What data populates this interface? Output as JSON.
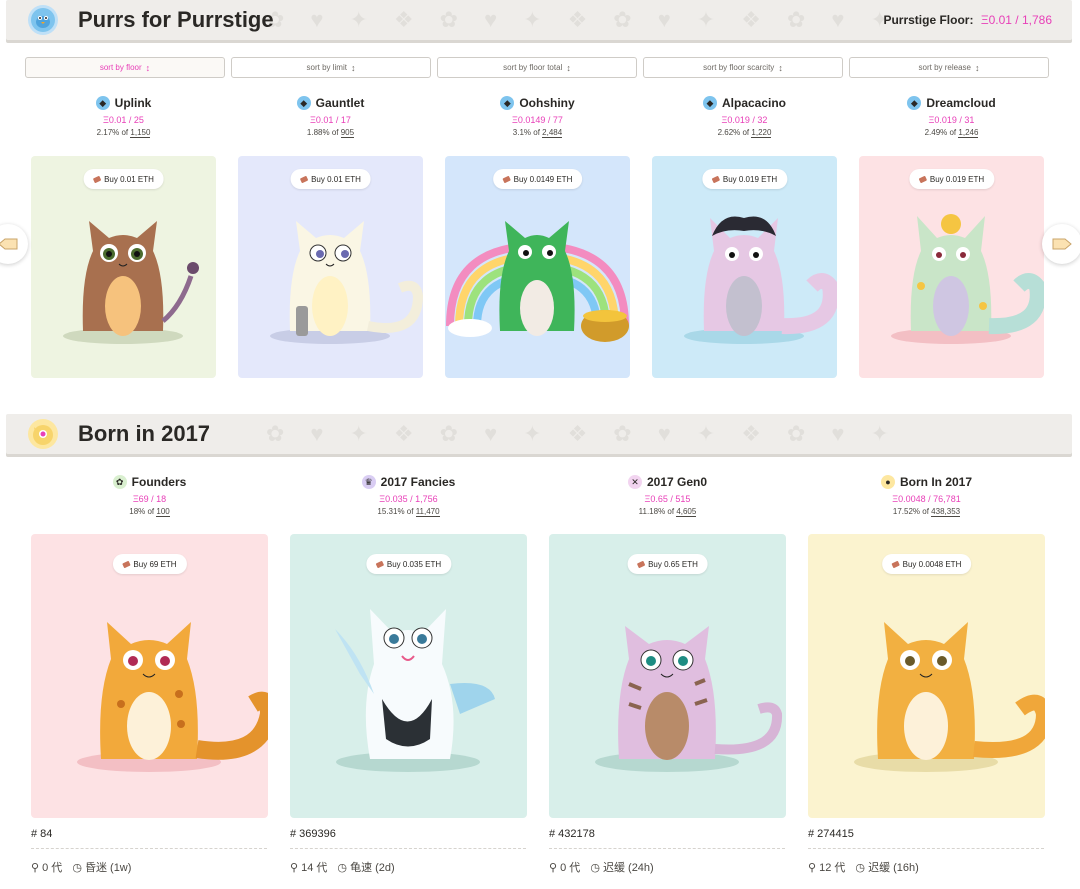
{
  "purrstige": {
    "title": "Purrs for Purrstige",
    "floor_label": "Purrstige Floor:",
    "floor_value": "Ξ0.01 / 1,786",
    "sort_buttons": [
      "sort by floor",
      "sort by limit",
      "sort by floor total",
      "sort by floor scarcity",
      "sort by release"
    ],
    "sort_arrow": "↕",
    "collections": [
      {
        "name": "Uplink",
        "price": "Ξ0.01 / 25",
        "pct": "2.17% of",
        "total": "1,150",
        "buy": "Buy  0.01 ETH"
      },
      {
        "name": "Gauntlet",
        "price": "Ξ0.01 / 17",
        "pct": "1.88% of",
        "total": "905",
        "buy": "Buy  0.01 ETH"
      },
      {
        "name": "Oohshiny",
        "price": "Ξ0.0149 / 77",
        "pct": "3.1% of",
        "total": "2,484",
        "buy": "Buy  0.0149 ETH"
      },
      {
        "name": "Alpacacino",
        "price": "Ξ0.019 / 32",
        "pct": "2.62% of",
        "total": "1,220",
        "buy": "Buy  0.019 ETH"
      },
      {
        "name": "Dreamcloud",
        "price": "Ξ0.019 / 31",
        "pct": "2.49% of",
        "total": "1,246",
        "buy": "Buy  0.019 ETH"
      }
    ]
  },
  "born2017": {
    "title": "Born in 2017",
    "collections": [
      {
        "name": "Founders",
        "price": "Ξ69 / 18",
        "pct": "18% of",
        "total": "100",
        "buy": "Buy  69 ETH",
        "id": "# 84",
        "gen": "0 代",
        "speed": "昏迷 (1w)"
      },
      {
        "name": "2017 Fancies",
        "price": "Ξ0.035 / 1,756",
        "pct": "15.31% of",
        "total": "11,470",
        "buy": "Buy  0.035 ETH",
        "id": "# 369396",
        "gen": "14 代",
        "speed": "龟速 (2d)"
      },
      {
        "name": "2017 Gen0",
        "price": "Ξ0.65 / 515",
        "pct": "11.18% of",
        "total": "4,605",
        "buy": "Buy  0.65 ETH",
        "id": "# 432178",
        "gen": "0 代",
        "speed": "迟缓 (24h)"
      },
      {
        "name": "Born In 2017",
        "price": "Ξ0.0048 / 76,781",
        "pct": "17.52% of",
        "total": "438,353",
        "buy": "Buy  0.0048 ETH",
        "id": "# 274415",
        "gen": "12 代",
        "speed": "迟缓 (16h)"
      }
    ]
  },
  "colors": {
    "accent": "#e83fb8",
    "card_bgs_top": [
      "#eef4e1",
      "#e4e8fb",
      "#d4e6fb",
      "#cdeaf8",
      "#fde2e4"
    ],
    "card_bgs_bottom": [
      "#fde2e4",
      "#d8efea",
      "#d8efea",
      "#fbf3cf"
    ]
  },
  "icons": {
    "section1_badge": "bird-icon",
    "section2_badge": "cat-icon",
    "arrow_left": "paw-left-icon",
    "arrow_right": "paw-right-icon"
  }
}
